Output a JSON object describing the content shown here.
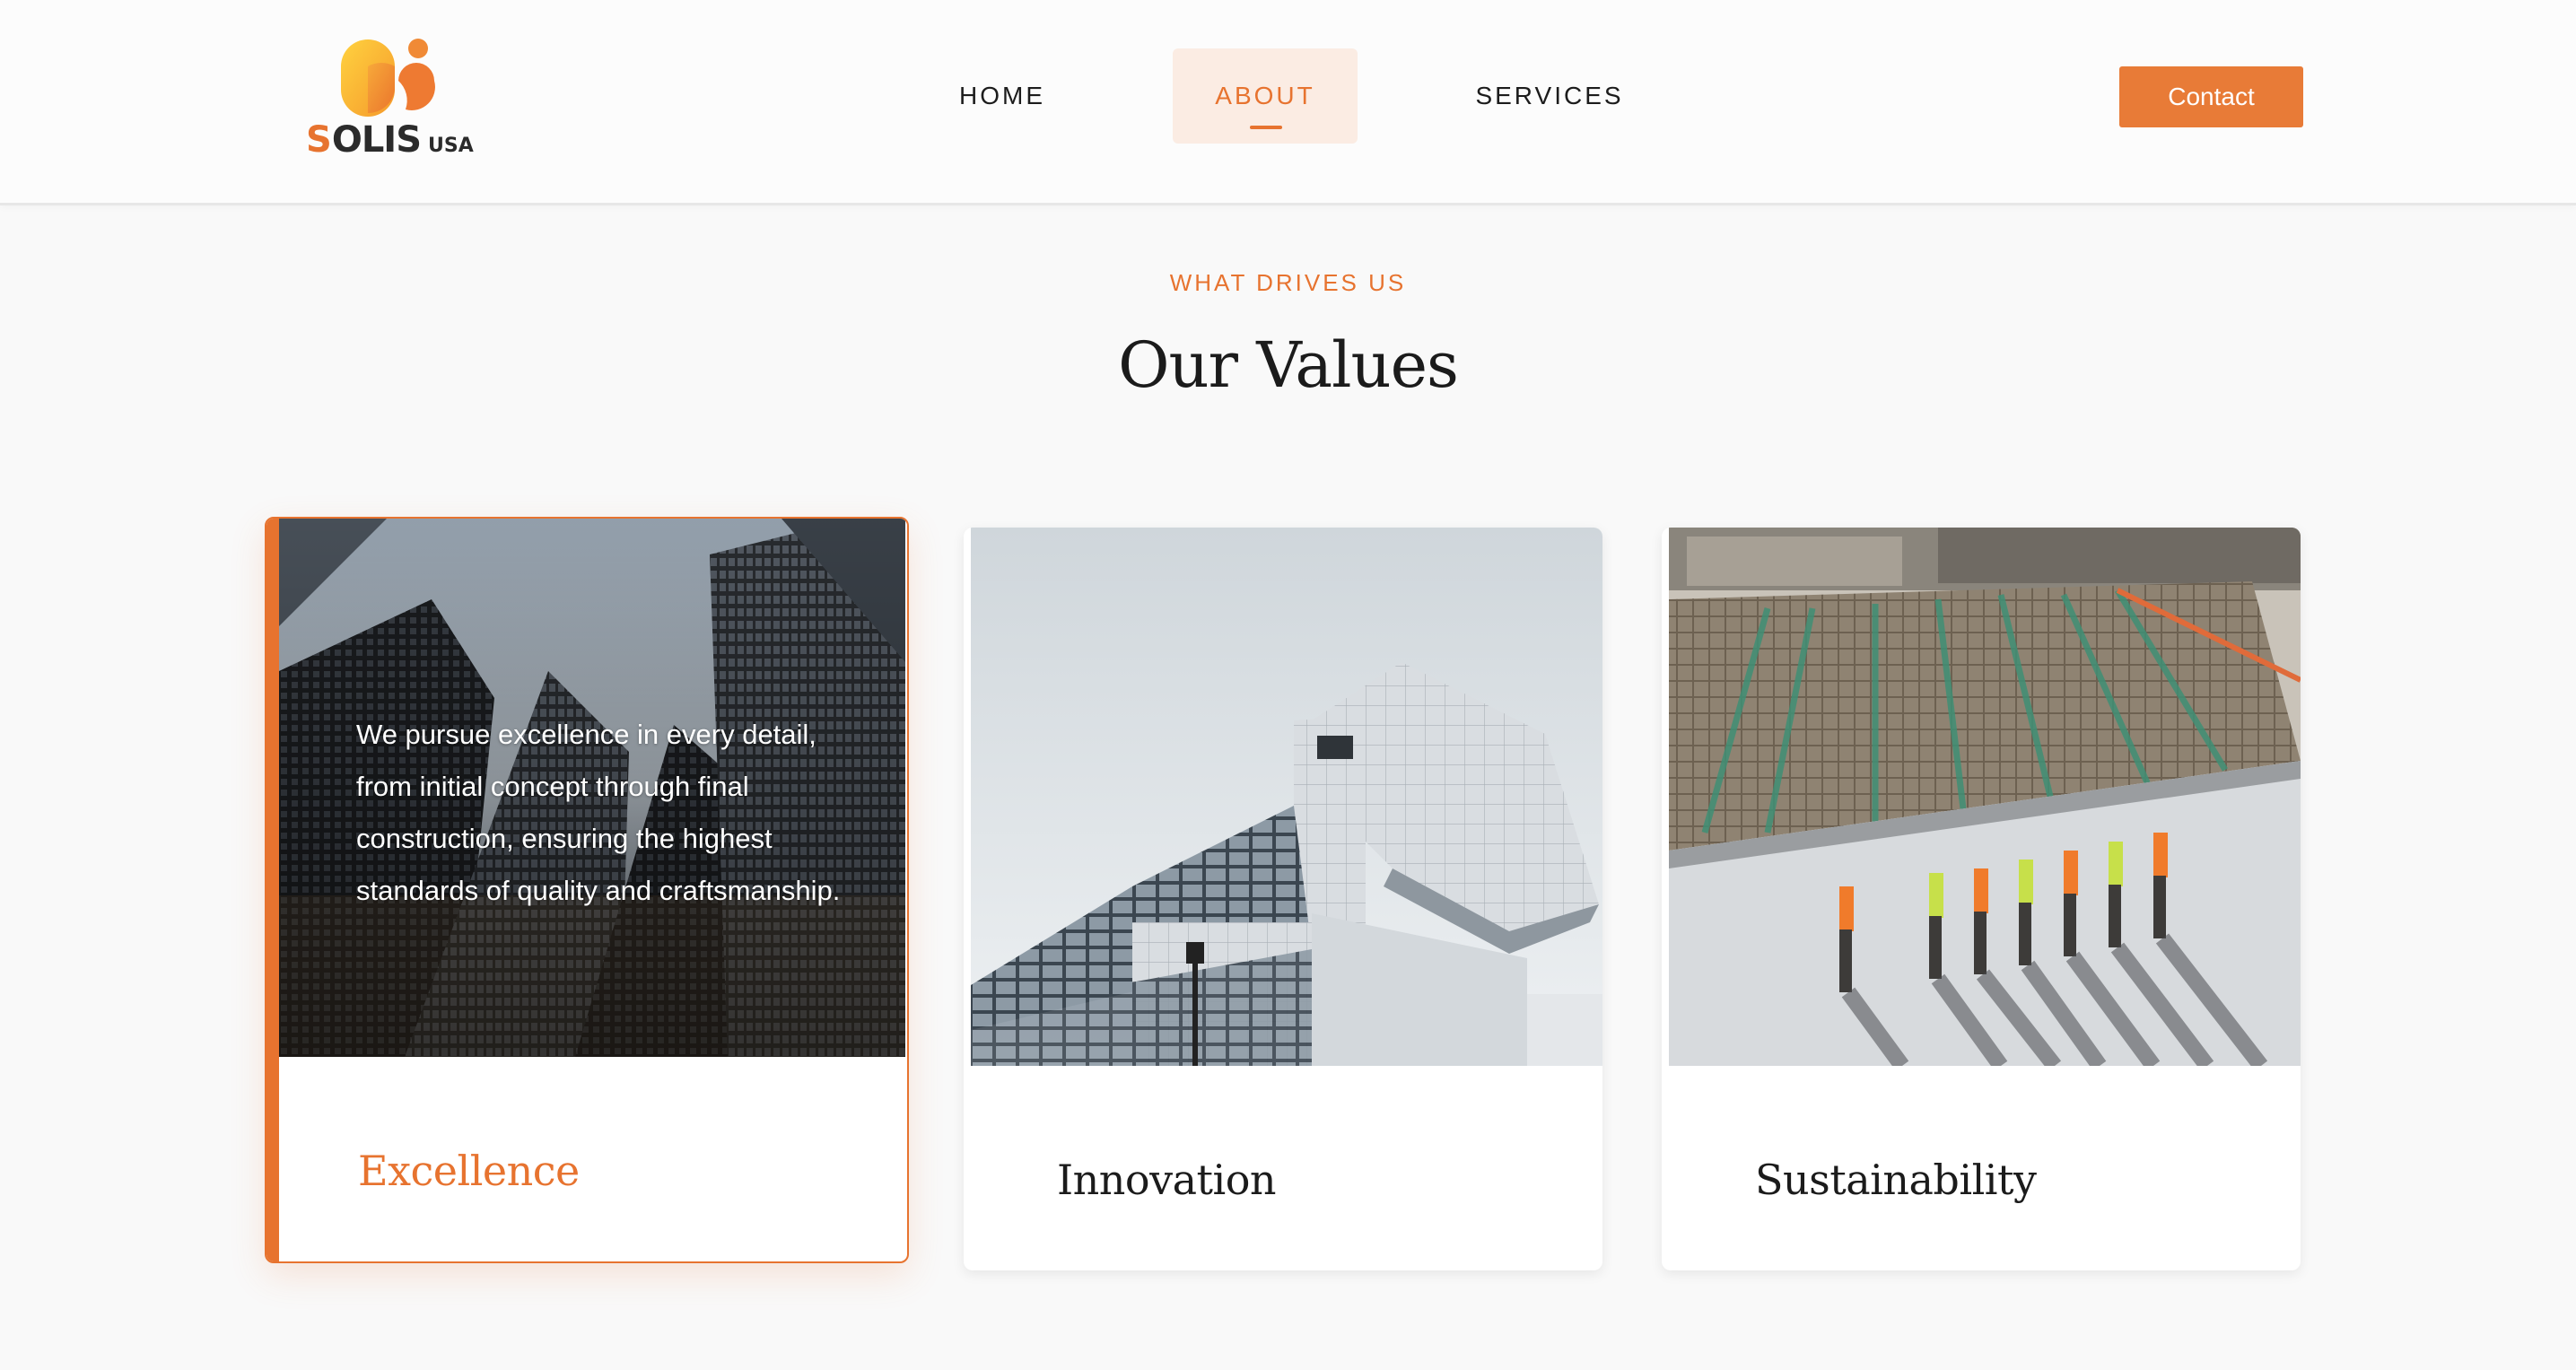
{
  "header": {
    "logo": {
      "brand_first_letter": "S",
      "brand_rest": "OLIS",
      "brand_suffix": "USA"
    },
    "nav": [
      {
        "label": "HOME",
        "active": false
      },
      {
        "label": "ABOUT",
        "active": true
      },
      {
        "label": "SERVICES",
        "active": false
      }
    ],
    "contact_label": "Contact"
  },
  "section": {
    "eyebrow": "WHAT DRIVES US",
    "title": "Our Values"
  },
  "cards": [
    {
      "title": "Excellence",
      "description": "We pursue excellence in every detail, from initial concept through final construction, ensuring the highest standards of quality and craftsmanship.",
      "image": "skyscrapers-photo",
      "active": true
    },
    {
      "title": "Innovation",
      "image": "modern-building-photo",
      "active": false
    },
    {
      "title": "Sustainability",
      "image": "construction-site-photo",
      "active": false
    }
  ],
  "colors": {
    "accent": "#e7732f",
    "button": "#e87b37",
    "nav_active_bg": "#fbece3",
    "background": "#f9f9f9",
    "text": "#1b1b1b"
  }
}
